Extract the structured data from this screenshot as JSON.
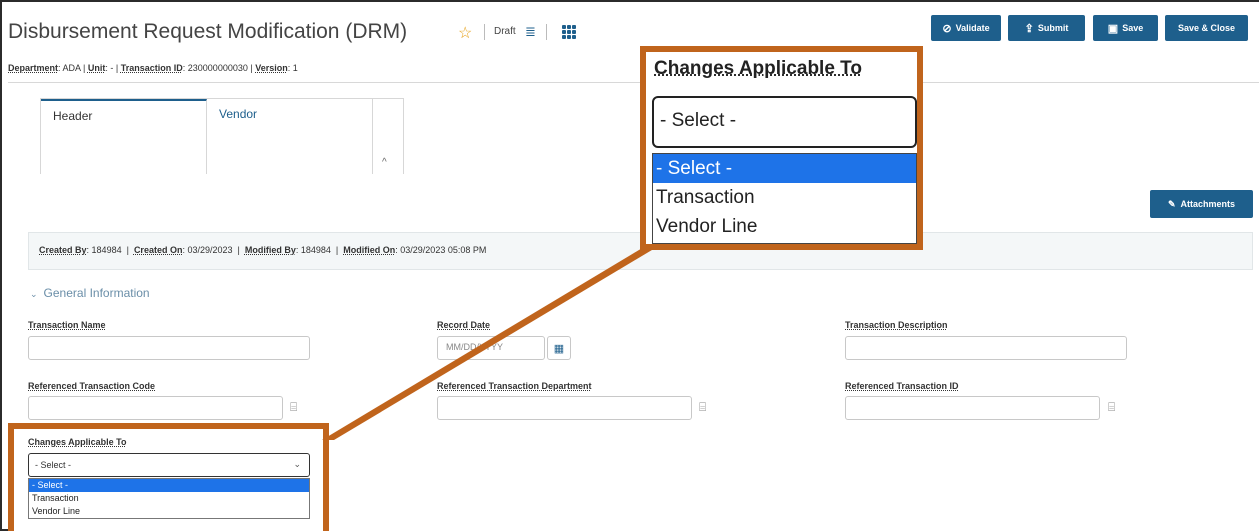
{
  "header": {
    "title": "Disbursement Request Modification (DRM)",
    "status": "Draft",
    "meta": {
      "department_label": "Department",
      "department": "ADA",
      "unit_label": "Unit",
      "unit": "-",
      "transaction_id_label": "Transaction ID",
      "transaction_id": "230000000030",
      "version_label": "Version",
      "version": "1"
    }
  },
  "toolbar": {
    "validate": "Validate",
    "submit": "Submit",
    "save": "Save",
    "save_close": "Save & Close",
    "attachments": "Attachments"
  },
  "tabs": [
    {
      "label": "Header"
    },
    {
      "label": "Vendor"
    }
  ],
  "audit": {
    "created_by_label": "Created By",
    "created_by": "184984",
    "created_on_label": "Created On",
    "created_on": "03/29/2023",
    "modified_by_label": "Modified By",
    "modified_by": "184984",
    "modified_on_label": "Modified On",
    "modified_on": "03/29/2023 05:08 PM"
  },
  "section": {
    "title": "General Information"
  },
  "fields": {
    "transaction_name": {
      "label": "Transaction Name",
      "value": ""
    },
    "record_date": {
      "label": "Record Date",
      "placeholder": "MM/DD/YYYY"
    },
    "transaction_description": {
      "label": "Transaction Description",
      "value": ""
    },
    "ref_transaction_code": {
      "label": "Referenced Transaction Code",
      "value": ""
    },
    "ref_transaction_department": {
      "label": "Referenced Transaction Department",
      "value": ""
    },
    "ref_transaction_id": {
      "label": "Referenced Transaction ID",
      "value": ""
    },
    "changes_applicable_to": {
      "label": "Changes Applicable To",
      "selected": "- Select -",
      "options": [
        "- Select -",
        "Transaction",
        "Vendor Line"
      ]
    }
  },
  "colors": {
    "primary": "#1e5f8c",
    "highlight_border": "#c0641c",
    "option_highlight": "#1e73e8",
    "star": "#e6a117"
  }
}
